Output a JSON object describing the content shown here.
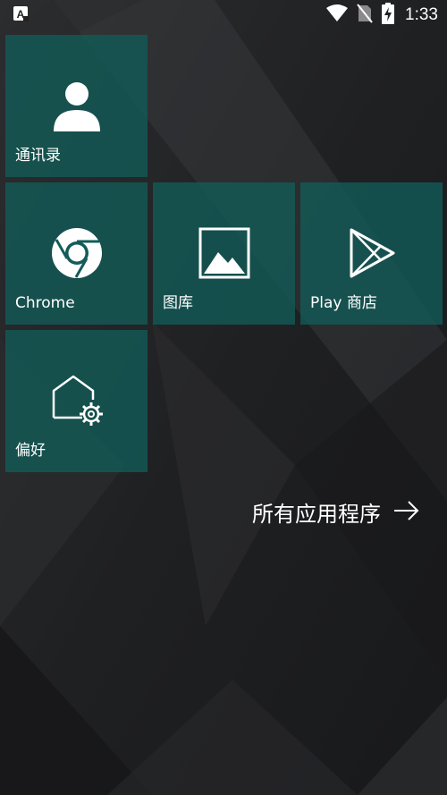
{
  "status_bar": {
    "time": "1:33",
    "left_icon": "accessibility-a-icon",
    "icons": [
      "wifi-icon",
      "no-sim-icon",
      "battery-charging-icon"
    ]
  },
  "tiles": [
    {
      "label": "通讯录",
      "icon": "contact-person-icon"
    },
    {
      "label": "Chrome",
      "icon": "chrome-icon"
    },
    {
      "label": "图库",
      "icon": "gallery-picture-icon"
    },
    {
      "label": "Play 商店",
      "icon": "play-store-icon"
    },
    {
      "label": "偏好",
      "icon": "house-settings-icon"
    }
  ],
  "all_apps": {
    "label": "所有应用程序",
    "icon": "arrow-right-icon"
  },
  "colors": {
    "tile": "#125c58",
    "background": "#1f2022",
    "text": "#ffffff"
  }
}
